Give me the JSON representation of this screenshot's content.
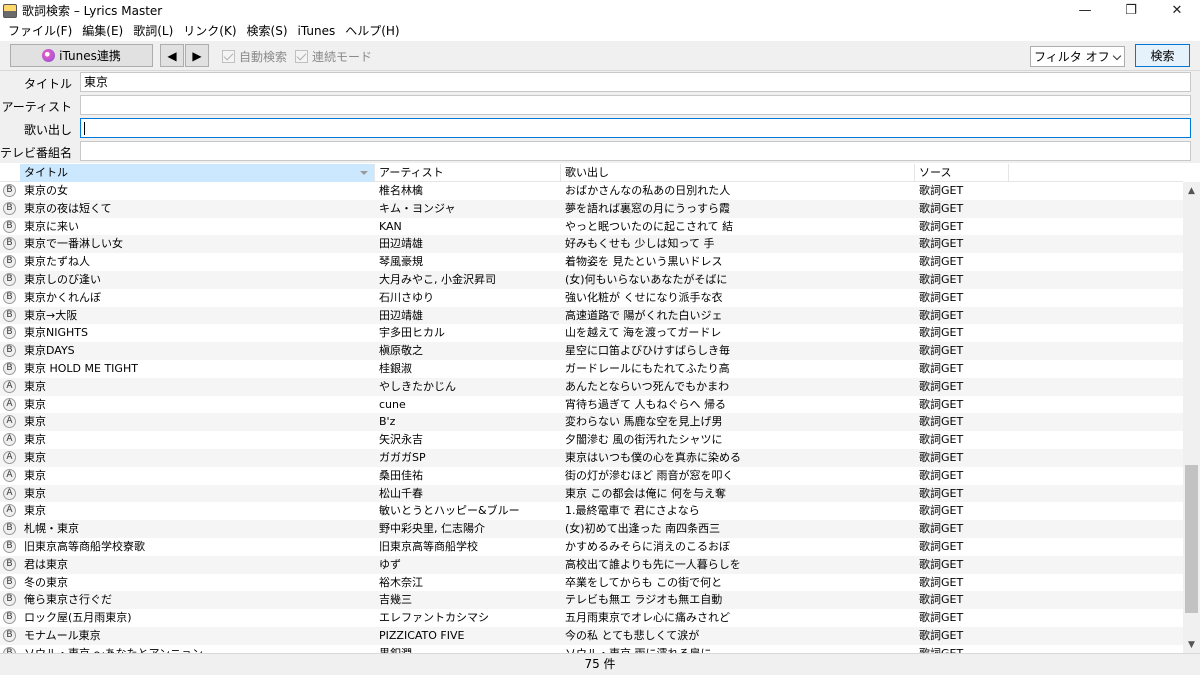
{
  "window": {
    "title": "歌詞検索 – Lyrics Master",
    "minimize": "—",
    "maximize": "❐",
    "close": "✕"
  },
  "menu": [
    "ファイル(F)",
    "編集(E)",
    "歌詞(L)",
    "リンク(K)",
    "検索(S)",
    "iTunes",
    "ヘルプ(H)"
  ],
  "toolbar": {
    "itunes_label": "iTunes連携",
    "prev_glyph": "◀",
    "next_glyph": "▶",
    "auto_search_label": "自動検索",
    "continuous_label": "連続モード",
    "filter_value": "フィルタ オフ",
    "search_label": "検索"
  },
  "form": {
    "title_label": "タイトル",
    "title_value": "東京",
    "artist_label": "アーティスト",
    "artist_value": "",
    "lyric_label": "歌い出し",
    "lyric_value": "",
    "tv_label": "テレビ番組名",
    "tv_value": ""
  },
  "grid": {
    "columns": [
      "タイトル",
      "アーティスト",
      "歌い出し",
      "ソース"
    ],
    "rows": [
      {
        "type": "B",
        "title": "東京の女",
        "artist": "椎名林檎",
        "lyric": "おばかさんなの私あの日別れた人",
        "source": "歌詞GET"
      },
      {
        "type": "B",
        "title": "東京の夜は短くて",
        "artist": "キム・ヨンジャ",
        "lyric": "夢を語れば裏窓の月にうっすら霞",
        "source": "歌詞GET"
      },
      {
        "type": "B",
        "title": "東京に来い",
        "artist": "KAN",
        "lyric": "やっと眠ついたのに起こされて 結",
        "source": "歌詞GET"
      },
      {
        "type": "B",
        "title": "東京で一番淋しい女",
        "artist": "田辺靖雄",
        "lyric": "好みもくせも 少しは知って 手",
        "source": "歌詞GET"
      },
      {
        "type": "B",
        "title": "東京たずね人",
        "artist": "琴風豪規",
        "lyric": "着物姿を 見たという黒いドレス",
        "source": "歌詞GET"
      },
      {
        "type": "B",
        "title": "東京しのび逢い",
        "artist": "大月みやこ, 小金沢昇司",
        "lyric": "(女)何もいらないあなたがそばに",
        "source": "歌詞GET"
      },
      {
        "type": "B",
        "title": "東京かくれんぼ",
        "artist": "石川さゆり",
        "lyric": "強い化粧が くせになり派手な衣",
        "source": "歌詞GET"
      },
      {
        "type": "B",
        "title": "東京→大阪",
        "artist": "田辺靖雄",
        "lyric": "高速道路で 陽がくれた白いジェ",
        "source": "歌詞GET"
      },
      {
        "type": "B",
        "title": "東京NIGHTS",
        "artist": "宇多田ヒカル",
        "lyric": "山を越えて 海を渡ってガードレ",
        "source": "歌詞GET"
      },
      {
        "type": "B",
        "title": "東京DAYS",
        "artist": "槇原敬之",
        "lyric": "星空に口笛よびひけすばらしき毎",
        "source": "歌詞GET"
      },
      {
        "type": "B",
        "title": "東京 HOLD ME TIGHT",
        "artist": "桂銀淑",
        "lyric": "ガードレールにもたれてふたり高",
        "source": "歌詞GET"
      },
      {
        "type": "A",
        "title": "東京",
        "artist": "やしきたかじん",
        "lyric": "あんたとならいつ死んでもかまわ",
        "source": "歌詞GET"
      },
      {
        "type": "A",
        "title": "東京",
        "artist": "cune",
        "lyric": "宵待ち過ぎて 人もねぐらへ 帰る",
        "source": "歌詞GET"
      },
      {
        "type": "A",
        "title": "東京",
        "artist": "B'z",
        "lyric": "変わらない 馬鹿な空を見上げ男",
        "source": "歌詞GET"
      },
      {
        "type": "A",
        "title": "東京",
        "artist": "矢沢永吉",
        "lyric": "夕闇滲む 風の街汚れたシャツに",
        "source": "歌詞GET"
      },
      {
        "type": "A",
        "title": "東京",
        "artist": "ガガガSP",
        "lyric": "東京はいつも僕の心を真赤に染める",
        "source": "歌詞GET"
      },
      {
        "type": "A",
        "title": "東京",
        "artist": "桑田佳祐",
        "lyric": "街の灯が滲むほど 雨音が窓を叩く",
        "source": "歌詞GET"
      },
      {
        "type": "A",
        "title": "東京",
        "artist": "松山千春",
        "lyric": "東京 この都会は俺に 何を与え奪",
        "source": "歌詞GET"
      },
      {
        "type": "A",
        "title": "東京",
        "artist": "敏いとうとハッピー&ブルー",
        "lyric": "1.最終電車で 君にさよなら",
        "source": "歌詞GET"
      },
      {
        "type": "B",
        "title": "札幌・東京",
        "artist": "野中彩央里, 仁志陽介",
        "lyric": "(女)初めて出逢った 南四条西三",
        "source": "歌詞GET"
      },
      {
        "type": "B",
        "title": "旧東京高等商船学校寮歌",
        "artist": "旧東京高等商船学校",
        "lyric": "かすめるみそらに消えのこるおぼ",
        "source": "歌詞GET"
      },
      {
        "type": "B",
        "title": "君は東京",
        "artist": "ゆず",
        "lyric": "高校出て誰よりも先に一人暮らしを",
        "source": "歌詞GET"
      },
      {
        "type": "B",
        "title": "冬の東京",
        "artist": "裕木奈江",
        "lyric": "卒業をしてからも この街で何と",
        "source": "歌詞GET"
      },
      {
        "type": "B",
        "title": "俺ら東京さ行ぐだ",
        "artist": "吉幾三",
        "lyric": "テレビも無エ ラジオも無エ自動",
        "source": "歌詞GET"
      },
      {
        "type": "B",
        "title": "ロック屋(五月雨東京)",
        "artist": "エレファントカシマシ",
        "lyric": "五月雨東京でオレ心に痛みされど",
        "source": "歌詞GET"
      },
      {
        "type": "B",
        "title": "モナムール東京",
        "artist": "PIZZICATO FIVE",
        "lyric": "今の私 とても悲しくて涙が",
        "source": "歌詞GET"
      },
      {
        "type": "B",
        "title": "ソウル・東京 〜あなたとアンニョン",
        "artist": "黒釦潤",
        "lyric": "ソウル・東京 雨に濡れる肩に",
        "source": "歌詞GET"
      }
    ]
  },
  "status": {
    "count": "75 件"
  }
}
